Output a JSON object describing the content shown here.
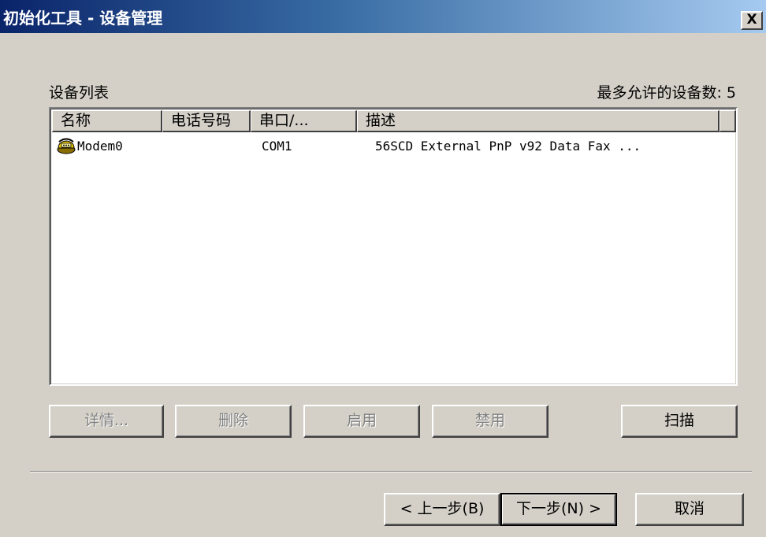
{
  "window": {
    "title": "初始化工具 - 设备管理",
    "close_label": "X"
  },
  "device_list": {
    "label": "设备列表",
    "max_devices_label": "最多允许的设备数: 5",
    "columns": [
      "名称",
      "电话号码",
      "串口/...",
      "描述"
    ],
    "rows": [
      {
        "icon": "modem-icon",
        "name": "Modem0",
        "phone": "",
        "port": "COM1",
        "description": "56SCD External PnP v92 Data Fax ..."
      }
    ]
  },
  "buttons": {
    "details": "详情...",
    "delete": "删除",
    "enable": "启用",
    "disable": "禁用",
    "scan": "扫描",
    "back": "< 上一步(B)",
    "next": "下一步(N) >",
    "cancel": "取消"
  },
  "colors": {
    "titlebar_start": "#0a246a",
    "titlebar_end": "#a6caf0",
    "face": "#d4d0c8"
  }
}
